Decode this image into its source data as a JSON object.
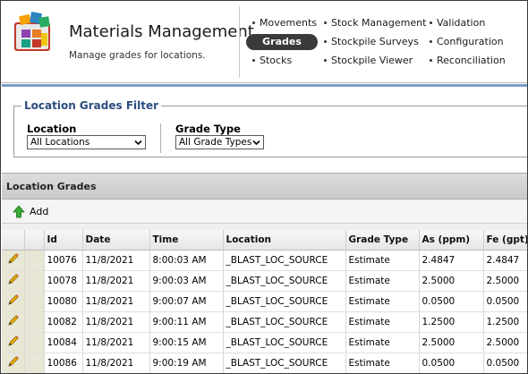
{
  "app": {
    "title": "Materials Management",
    "subtitle": "Manage grades for locations."
  },
  "nav": {
    "col1": [
      {
        "label": "Movements",
        "active": false
      },
      {
        "label": "Grades",
        "active": true
      },
      {
        "label": "Stocks",
        "active": false
      }
    ],
    "col2": [
      {
        "label": "Stock Management",
        "active": false
      },
      {
        "label": "Stockpile Surveys",
        "active": false
      },
      {
        "label": "Stockpile Viewer",
        "active": false
      }
    ],
    "col3": [
      {
        "label": "Validation",
        "active": false
      },
      {
        "label": "Configuration",
        "active": false
      },
      {
        "label": "Reconciliation",
        "active": false
      }
    ]
  },
  "filter": {
    "legend": "Location Grades Filter",
    "location_label": "Location",
    "location_value": "All Locations",
    "grade_type_label": "Grade Type",
    "grade_type_value": "All Grade Types"
  },
  "grid": {
    "title": "Location Grades",
    "add_label": "Add",
    "columns": [
      "Id",
      "Date",
      "Time",
      "Location",
      "Grade Type",
      "As (ppm)",
      "Fe (gpt)"
    ],
    "rows": [
      [
        "10076",
        "11/8/2021",
        "8:00:03 AM",
        "_BLAST_LOC_SOURCE",
        "Estimate",
        "2.4847",
        "2.4847"
      ],
      [
        "10078",
        "11/8/2021",
        "9:00:03 AM",
        "_BLAST_LOC_SOURCE",
        "Estimate",
        "2.5000",
        "2.5000"
      ],
      [
        "10080",
        "11/8/2021",
        "9:00:07 AM",
        "_BLAST_LOC_SOURCE",
        "Estimate",
        "0.0500",
        "0.0500"
      ],
      [
        "10082",
        "11/8/2021",
        "9:00:11 AM",
        "_BLAST_LOC_SOURCE",
        "Estimate",
        "1.2500",
        "1.2500"
      ],
      [
        "10084",
        "11/8/2021",
        "9:00:15 AM",
        "_BLAST_LOC_SOURCE",
        "Estimate",
        "2.5000",
        "2.5000"
      ],
      [
        "10086",
        "11/8/2021",
        "9:00:19 AM",
        "_BLAST_LOC_SOURCE",
        "Estimate",
        "0.0500",
        "0.0500"
      ]
    ]
  },
  "icons": {
    "logo": "app-logo-icon",
    "add": "green-up-arrow-icon",
    "edit": "pencil-icon",
    "dropdown": "chevron-down-icon"
  },
  "colors": {
    "active_nav": "#3a3a3a",
    "legend_text": "#2b4c7e",
    "filter_border_top": "#7a9ccd",
    "edit_column_bg": "#e8e6d4"
  }
}
